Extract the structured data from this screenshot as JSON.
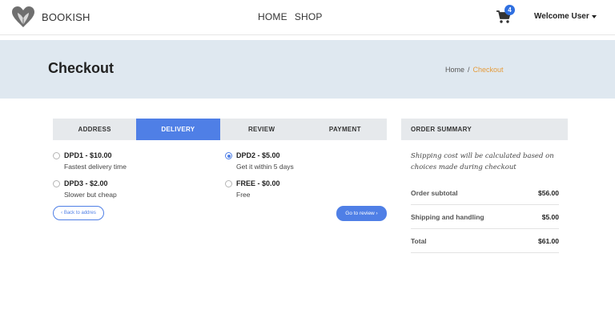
{
  "brand": {
    "name": "BOOKISH",
    "logo_icon": "heart-book-logo"
  },
  "nav": {
    "home": "HOME",
    "shop": "SHOP"
  },
  "cart": {
    "icon": "shopping-cart-icon",
    "count": "4"
  },
  "user": {
    "label": "Welcome User"
  },
  "header": {
    "title": "Checkout",
    "breadcrumb": {
      "home": "Home",
      "sep": "/",
      "current": "Checkout"
    }
  },
  "tabs": [
    {
      "label": "ADDRESS",
      "active": false
    },
    {
      "label": "DELIVERY",
      "active": true
    },
    {
      "label": "REVIEW",
      "active": false
    },
    {
      "label": "PAYMENT",
      "active": false
    }
  ],
  "delivery_options": [
    {
      "title": "DPD1 - $10.00",
      "desc": "Fastest delivery time",
      "selected": false
    },
    {
      "title": "DPD2 - $5.00",
      "desc": "Get it within 5 days",
      "selected": true
    },
    {
      "title": "DPD3 - $2.00",
      "desc": "Slower but cheap",
      "selected": false
    },
    {
      "title": "FREE - $0.00",
      "desc": "Free",
      "selected": false
    }
  ],
  "buttons": {
    "back": "‹ Back to addres",
    "next": "Go to review ›"
  },
  "summary": {
    "heading": "ORDER SUMMARY",
    "note": "Shipping cost will be calculated based on choices made during checkout",
    "rows": [
      {
        "label": "Order subtotal",
        "value": "$56.00"
      },
      {
        "label": "Shipping and handling",
        "value": "$5.00"
      },
      {
        "label": "Total",
        "value": "$61.00"
      }
    ]
  },
  "colors": {
    "accent": "#4f7fe6",
    "breadcrumb_active": "#e59b3a",
    "hero_bg": "#dfe8f0"
  }
}
